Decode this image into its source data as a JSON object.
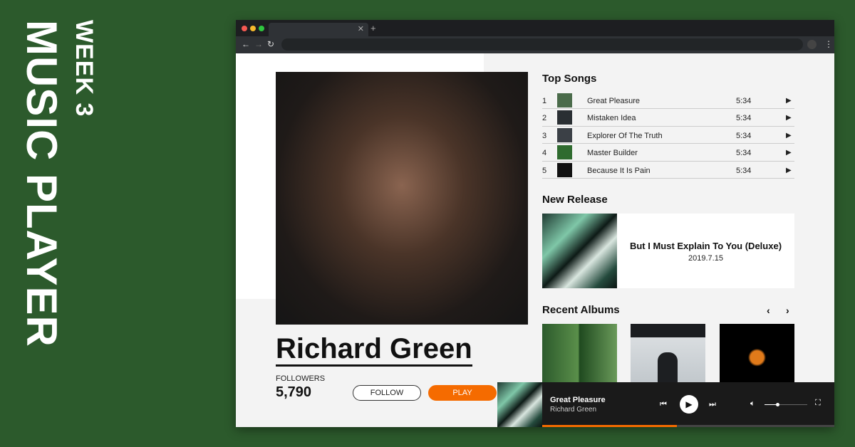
{
  "side": {
    "week": "WEEK 3",
    "title": "MUSIC PLAYER"
  },
  "artist": {
    "name": "Richard Green",
    "followers_label": "FOLLOWERS",
    "followers": "5,790",
    "follow": "FOLLOW",
    "play": "PLAY"
  },
  "top_songs": {
    "title": "Top Songs",
    "songs": [
      {
        "n": "1",
        "title": "Great Pleasure",
        "time": "5:34"
      },
      {
        "n": "2",
        "title": "Mistaken Idea",
        "time": "5:34"
      },
      {
        "n": "3",
        "title": "Explorer Of The Truth",
        "time": "5:34"
      },
      {
        "n": "4",
        "title": "Master Builder",
        "time": "5:34"
      },
      {
        "n": "5",
        "title": "Because It Is Pain",
        "time": "5:34"
      }
    ]
  },
  "new_release": {
    "title": "New Release",
    "album": "But I Must Explain To You (Deluxe)",
    "date": "2019.7.15"
  },
  "recent": {
    "title": "Recent Albums"
  },
  "player": {
    "title": "Great Pleasure",
    "artist": "Richard Green",
    "progress": 0.46,
    "volume": 0.3
  },
  "colors": {
    "accent": "#f56b00",
    "bg": "#2c5a2c"
  }
}
